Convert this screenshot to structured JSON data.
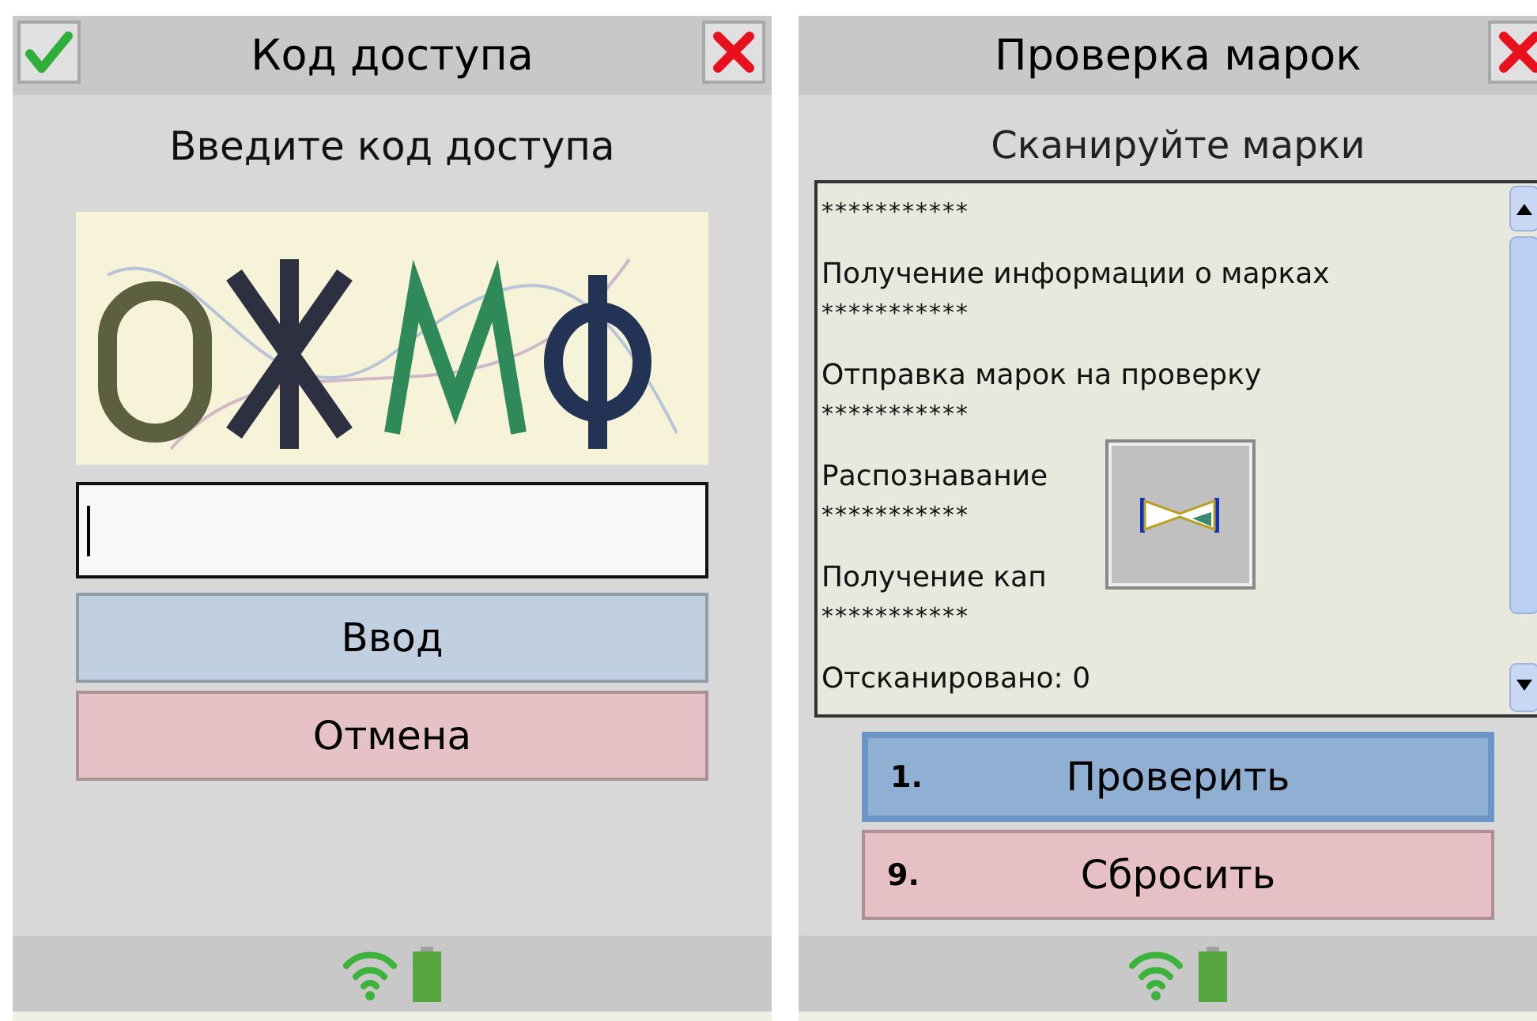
{
  "screens": [
    {
      "title": "Код доступа",
      "header_buttons": [
        {
          "kind": "confirm"
        },
        {
          "kind": "close"
        }
      ],
      "subtitle": "Введите код доступа",
      "blocks": [
        {
          "kind": "captcha"
        },
        {
          "kind": "input",
          "focused": true
        }
      ],
      "buttons": [
        {
          "label": "Ввод",
          "color": "#c0d0e0",
          "selected": false
        },
        {
          "label": "Отмена",
          "color": "#e6c2c6",
          "selected": false
        }
      ]
    },
    {
      "title": "Проверка марок",
      "header_buttons": [
        {
          "kind": "close"
        }
      ],
      "subtitle": "Сканируйте марки",
      "blocks": [
        {
          "kind": "log",
          "busy": true,
          "lines": [
            {
              "kind": "stars",
              "text": "***********"
            },
            {
              "kind": "text",
              "text": "Получение информации о марках"
            },
            {
              "kind": "stars",
              "text": "***********"
            },
            {
              "kind": "text",
              "text": "Отправка марок на проверку"
            },
            {
              "kind": "stars",
              "text": "***********"
            },
            {
              "kind": "text",
              "text": "Распознавание"
            },
            {
              "kind": "stars",
              "text": "***********"
            },
            {
              "kind": "text",
              "text": "Получение кап"
            },
            {
              "kind": "stars",
              "text": "***********"
            },
            {
              "kind": "text",
              "text": "Отсканировано: 0"
            }
          ]
        }
      ],
      "buttons": [
        {
          "hotkey": "1.",
          "label": "Проверить",
          "color": "#8fb0d2",
          "selected": true
        },
        {
          "hotkey": "9.",
          "label": "Сбросить",
          "color": "#e6c0c4",
          "selected": false
        }
      ]
    }
  ]
}
